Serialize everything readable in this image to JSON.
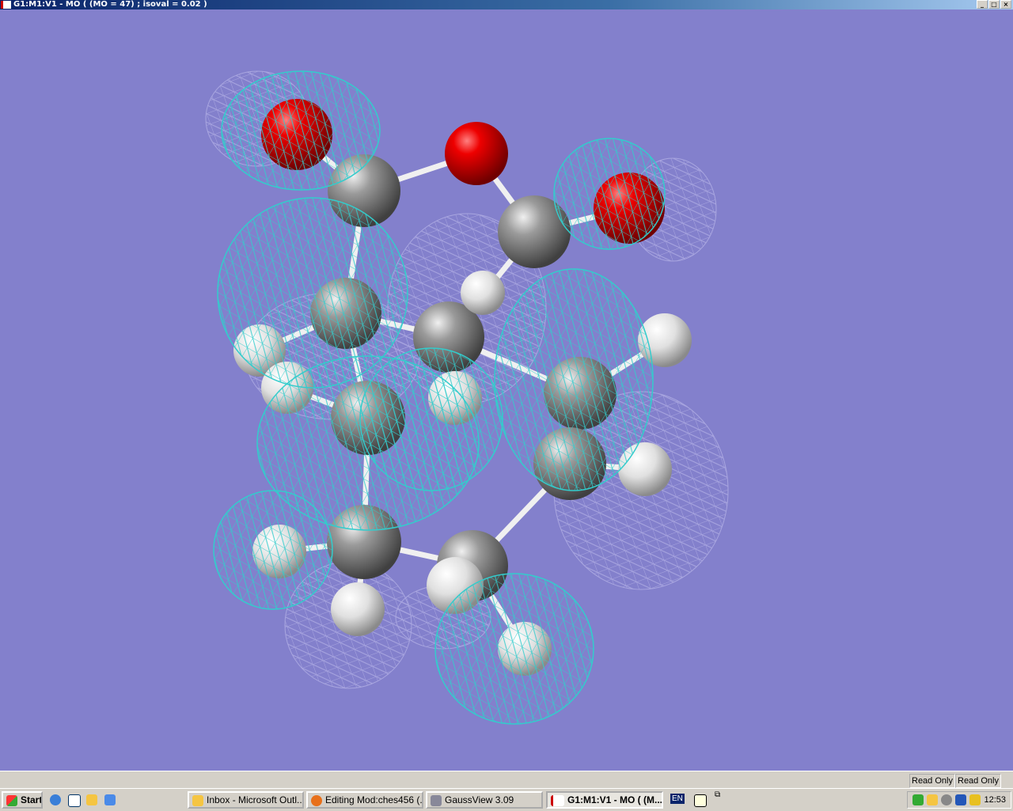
{
  "window": {
    "title": "G1:M1:V1 - MO ( (MO = 47) ; isoval = 0.02 )",
    "controls": [
      "minimize",
      "maximize",
      "close"
    ]
  },
  "statusbar": {
    "fields": [
      "Read Only",
      "Read Only"
    ]
  },
  "taskbar": {
    "start_label": "Start",
    "quick_launch": [
      "internet-explorer-icon",
      "show-desktop-icon",
      "outlook-icon",
      "update-icon"
    ],
    "tasks": [
      {
        "label": "Inbox - Microsoft Outl...",
        "icon": "outlook-icon"
      },
      {
        "label": "Editing Mod:ches456 (...",
        "icon": "firefox-icon"
      },
      {
        "label": "GaussView 3.09",
        "icon": "gaussview-icon"
      },
      {
        "label": "G1:M1:V1 - MO ( (M...",
        "icon": "gaussview-window-icon",
        "active": true
      }
    ],
    "language": "EN",
    "clock": "12:53"
  },
  "colors": {
    "background": "#8380cc",
    "positive_lobe": "#33cccc",
    "negative_lobe": "#a9a6e0",
    "oxygen": "#dd0000",
    "carbon": "#888888",
    "hydrogen": "#e8e8e8"
  }
}
